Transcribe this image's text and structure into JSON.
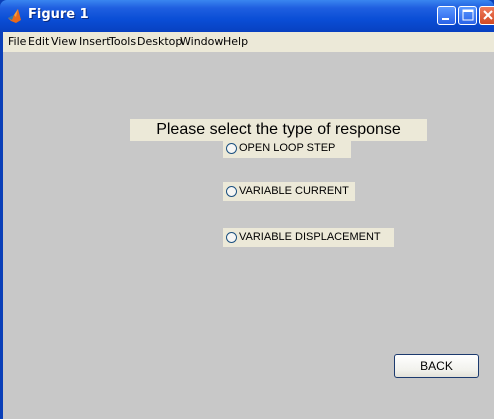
{
  "window": {
    "title": "Figure 1",
    "colors": {
      "titlebar": "#0a4ed6",
      "canvas": "#c8c8c8",
      "panel": "#ece9d8"
    }
  },
  "menu": {
    "items": [
      "File",
      "Edit",
      "View",
      "Insert",
      "Tools",
      "Desktop",
      "Window",
      "Help"
    ]
  },
  "main": {
    "heading": "Please select the type of response",
    "options": [
      {
        "label": "OPEN LOOP STEP",
        "selected": false
      },
      {
        "label": "VARIABLE CURRENT",
        "selected": false
      },
      {
        "label": "VARIABLE DISPLACEMENT",
        "selected": false
      }
    ],
    "back_label": "BACK"
  },
  "icons": {
    "app": "matlab-icon",
    "minimize": "minimize-icon",
    "maximize": "maximize-icon",
    "close": "close-icon"
  }
}
